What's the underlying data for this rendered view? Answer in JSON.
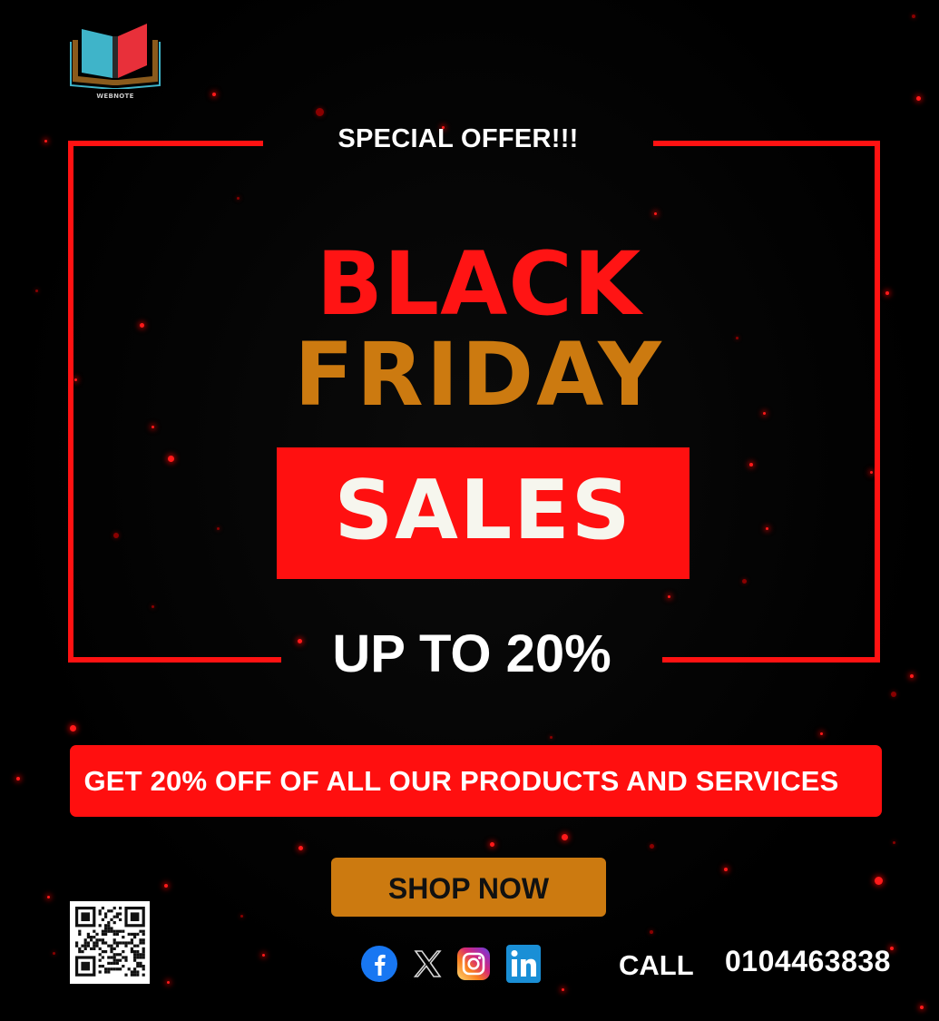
{
  "brand": {
    "logo_text": "WEBNOTE",
    "logo_colors": {
      "left_page": "#3fb4c9",
      "right_page": "#e8303a",
      "cover": "#8a5a1c"
    }
  },
  "headline": {
    "special_offer": "SPECIAL OFFER!!!",
    "line1": "BLACK",
    "line2": "FRIDAY",
    "sales": "SALES",
    "discount": "UP TO 20%"
  },
  "banner": {
    "text": "GET 20% OFF OF ALL OUR PRODUCTS AND SERVICES"
  },
  "cta": {
    "label": "SHOP NOW"
  },
  "social": [
    {
      "name": "facebook",
      "icon": "facebook-icon"
    },
    {
      "name": "x",
      "icon": "x-icon"
    },
    {
      "name": "instagram",
      "icon": "instagram-icon"
    },
    {
      "name": "linkedin",
      "icon": "linkedin-icon"
    }
  ],
  "contact": {
    "call_label": "CALL",
    "phone": "0104463838"
  },
  "colors": {
    "background": "#000000",
    "accent_red": "#ff1212",
    "accent_gold": "#cc7a10",
    "text_white": "#ffffff"
  }
}
